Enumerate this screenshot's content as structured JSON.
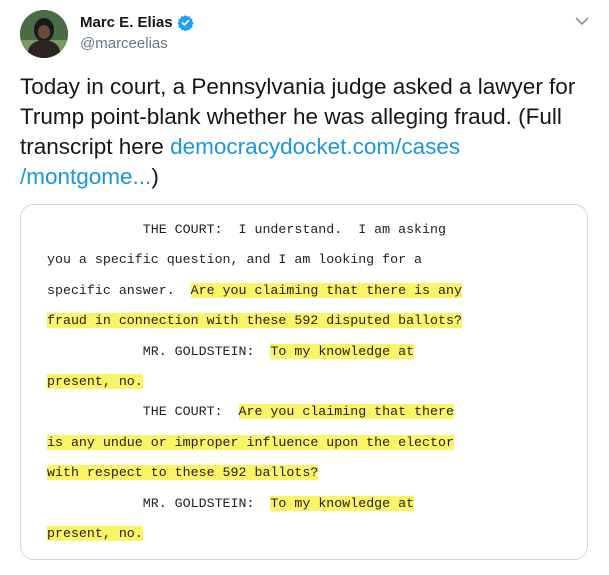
{
  "author": {
    "name": "Marc E. Elias",
    "handle": "@marceelias",
    "verified": true,
    "verified_icon": "verified-badge-icon",
    "avatar_icon": "avatar-photo",
    "more_icon": "chevron-down-icon"
  },
  "tweet": {
    "text_part1": "Today in court, a Pennsylvania judge asked a lawyer for Trump point-blank whether he was alleging fraud. (Full transcript here ",
    "link_text": "democracydocket.com/cases /montgome...",
    "text_part2": ")"
  },
  "transcript_lines": [
    {
      "indent": "            ",
      "pre": "THE COURT:  I understand.  I am asking",
      "hl": "",
      "post": ""
    },
    {
      "indent": "",
      "pre": "you a specific question, and I am looking for a",
      "hl": "",
      "post": ""
    },
    {
      "indent": "",
      "pre": "specific answer.  ",
      "hl": "Are you claiming that there is any",
      "post": ""
    },
    {
      "indent": "",
      "pre": "",
      "hl": "fraud in connection with these 592 disputed ballots?",
      "post": ""
    },
    {
      "indent": "            ",
      "pre": "MR. GOLDSTEIN:  ",
      "hl": "To my knowledge at",
      "post": ""
    },
    {
      "indent": "",
      "pre": "",
      "hl": "present, no.",
      "post": ""
    },
    {
      "indent": "            ",
      "pre": "THE COURT:  ",
      "hl": "Are you claiming that there",
      "post": ""
    },
    {
      "indent": "",
      "pre": "",
      "hl": "is any undue or improper influence upon the elector",
      "post": ""
    },
    {
      "indent": "",
      "pre": "",
      "hl": "with respect to these 592 ballots?",
      "post": ""
    },
    {
      "indent": "            ",
      "pre": "MR. GOLDSTEIN:  ",
      "hl": "To my knowledge at",
      "post": ""
    },
    {
      "indent": "",
      "pre": "",
      "hl": "present, no.",
      "post": ""
    }
  ],
  "colors": {
    "link": "#1b95e0",
    "highlight": "#fbf466",
    "verified": "#1da1f2",
    "handle": "#657786"
  }
}
